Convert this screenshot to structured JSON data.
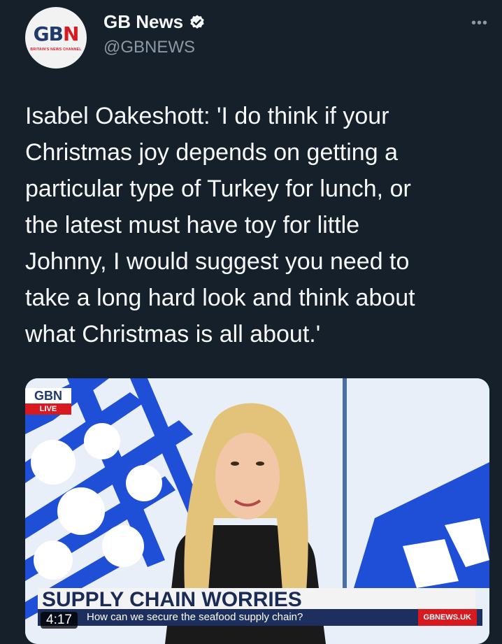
{
  "account": {
    "display_name": "GB News",
    "handle": "@GBNEWS",
    "avatar_logo_left": "GB",
    "avatar_logo_right": "N",
    "avatar_tagline": "BRITAIN'S NEWS CHANNEL",
    "verified": true
  },
  "more_label": "•••",
  "tweet": {
    "text": "Isabel Oakeshott: 'I do think if your\nChristmas joy depends on getting a\nparticular type of Turkey for lunch, or\nthe latest must have toy for little\nJohnny, I would suggest you need to\ntake a long hard look and think about\nwhat Christmas is all about.'"
  },
  "media": {
    "logo": "GBN",
    "live_label": "LIVE",
    "headline": "SUPPLY CHAIN WORRIES",
    "ticker": "How can we secure the seafood supply chain?",
    "brand_tag": "GBNEWS.UK",
    "duration": "4:17"
  },
  "colors": {
    "background": "#15202b",
    "text": "#f7f9f9",
    "muted": "#8b98a5",
    "verified": "#f7f9f9",
    "brand_red": "#d71920",
    "brand_blue": "#1f3a6b"
  }
}
